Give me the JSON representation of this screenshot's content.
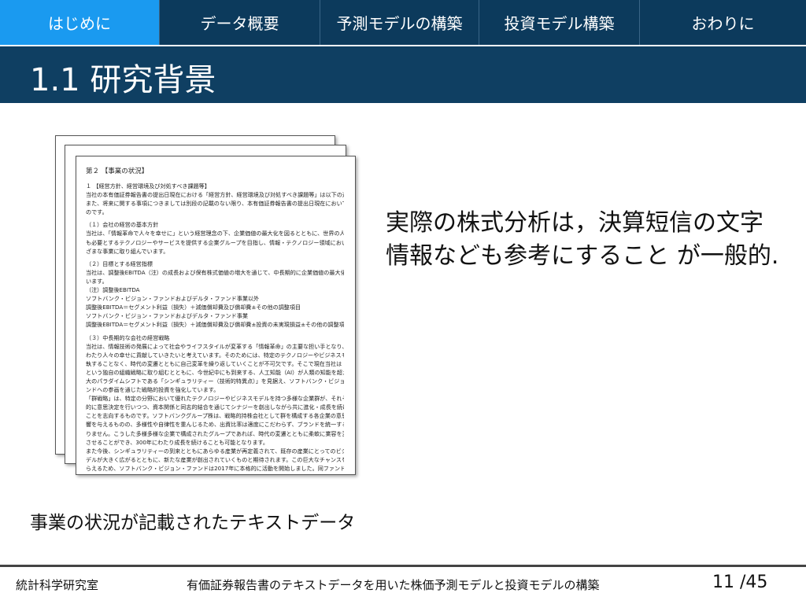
{
  "nav": {
    "tabs": [
      {
        "label": "はじめに",
        "active": true
      },
      {
        "label": "データ概要",
        "active": false
      },
      {
        "label": "予測モデルの構築",
        "active": false
      },
      {
        "label": "投資モデル構築",
        "active": false
      },
      {
        "label": "おわりに",
        "active": false
      }
    ]
  },
  "slide": {
    "title": "1.1 研究背景",
    "main_text": "実際の株式分析は，決算短信の文字情報なども参考にすること が一般的.",
    "caption": "事業の状況が記載されたテキストデータ"
  },
  "document": {
    "heading": "第２ 【事業の状況】",
    "lines": [
      "１ 【経営方針、経営環境及び対処すべき課題等】",
      "当社の本有価証券報告書の提出日現在における「経営方針、経営環境及び対処すべき課題等」は以下の通りです。",
      "また、将来に関する事項につきましては別段の記載のない限り、本有価証券報告書の提出日現在において判断したも",
      "のです。",
      "",
      "（１）会社の経営の基本方針",
      "当社は、「情報革命で人々を幸せに」という経営理念の下、企業価値の最大化を図るとともに、世界の人々が最",
      "も必要とするテクノロジーやサービスを提供する企業グループを目指し、情報・テクノロジー領域において、さま",
      "ざまな事業に取り組んでいます。",
      "",
      "（２）目標とする経営指標",
      "当社は、調整後EBITDA（注）の成長および保有株式価値の増大を通じて、中長期的に企業価値の最大化を図って",
      "います。",
      "（注）調整後EBITDA",
      "ソフトバンク・ビジョン・ファンドおよびデルタ・ファンド事業以外",
      "調整後EBITDA＝セグメント利益（損失）＋減価償却費及び償却費±その他の調整項目",
      "ソフトバンク・ビジョン・ファンドおよびデルタ・ファンド事業",
      "調整後EBITDA＝セグメント利益（損失）＋減価償却費及び償却費±投資の未実現損益±その他の調整項目",
      "",
      "（３）中長期的な会社の経営戦略",
      "当社は、情報技術の発展によって社会やライフスタイルが変革する「情報革命」の主要な担い手となり、長きに",
      "わたり人々の幸せに貢献していきたいと考えています。そのためには、特定のテクノロジーやビジネスモデルに固",
      "執することなく、時代の変遷とともに自己変革を繰り返していくことが不可欠です。そこで現在当社は「群戦略」",
      "という独自の組織戦略に取り組むとともに、今世紀中にも到来する、人工知能（AI）が人類の知能を超える局面",
      "大のパラダイムシフトである「シンギュラリティー（技術的特異点）」を見据え、ソフトバンク・ビジョン・ファ",
      "ンドへの参画を通じた戦略的投資を強化しています。",
      "「群戦略」は、特定の分野において優れたテクノロジーやビジネスモデルを持つ多様な企業群が、それぞれ自律",
      "的に意思決定を行いつつ、資本関係と同志的結合を通じてシナジーを創出しながら共に進化・成長を続けていく",
      "ことを志向するものです。ソフトバンクグループ株は、戦略的持株会社として群を構成する各企業の意思決定に影",
      "響を与えるものの、多様性や自律性を重んじるため、出資比率は適度にこだわらず、ブランドを統一することもあ",
      "りません。こうした多様多様な企業で構成されたグループであれば、時代の変遷とともに柔軟に業容を変化・拡大",
      "させることができ、300年にわたり成長を続けることも可能となります。",
      "また今後、シンギュラリティーの到来とともにあらゆる産業が再定義されて、既存の産業にとってのビジネスモ",
      "デルが大きく広がるとともに、新たな産業が創出されていくものと期待されます。この巨大なチャンスを確実にと",
      "らえるため、ソフトバンク・ビジョン・ファンドは2017年に本格的に活動を開始しました。同ファンドは、次世代"
    ]
  },
  "footer": {
    "left": "統計科学研究室",
    "center": "有価証券報告書のテキストデータを用いた株価予測モデルと投資モデルの構築",
    "page": "11 /45"
  }
}
